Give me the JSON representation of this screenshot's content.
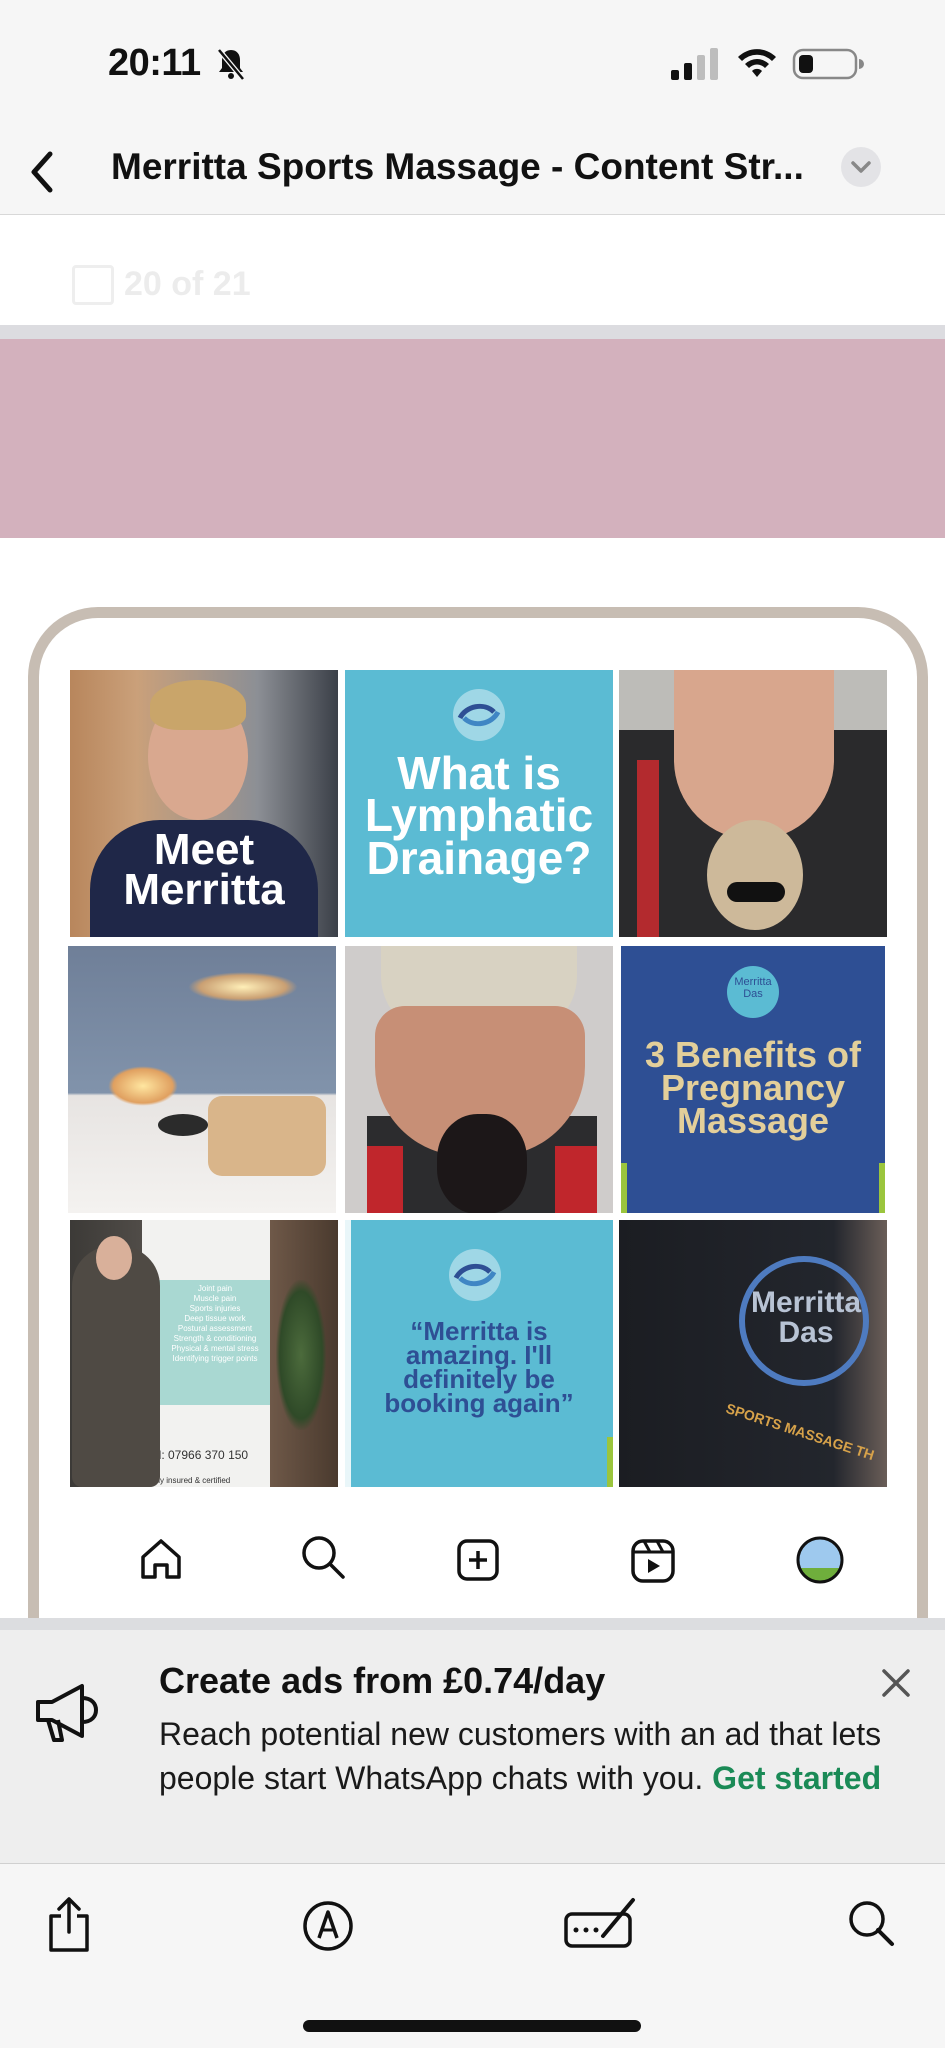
{
  "status_bar": {
    "time": "20:11"
  },
  "header": {
    "title": "Merritta Sports Massage - Content Str..."
  },
  "page_indicator": {
    "text": "20 of 21"
  },
  "grid": {
    "tile1_text": [
      "Meet",
      "Merritta"
    ],
    "tile2_text": [
      "What is",
      "Lymphatic",
      "Drainage?"
    ],
    "tile6_logo_text": [
      "Merritta",
      "Das"
    ],
    "tile6_text": [
      "3 Benefits of",
      "Pregnancy",
      "Massage"
    ],
    "tile7_poster_lines": [
      "Joint pain",
      "Muscle pain",
      "Sports injuries",
      "Deep tissue work",
      "Postural assessment",
      "Strength & conditioning",
      "Physical & mental stress",
      "Identifying trigger points"
    ],
    "tile7_phone": "el: 07966 370 150",
    "tile7_footer": "ully insured & certified",
    "tile8_text": [
      "“Merritta is",
      "amazing. I'll",
      "definitely be",
      "booking again”"
    ],
    "tile9_logo_text": [
      "Merritta",
      "Das"
    ],
    "tile9_arc_text": "SPORTS MASSAGE TH"
  },
  "ad": {
    "title": "Create ads from £0.74/day",
    "body": "Reach potential new customers with an ad that lets people start WhatsApp chats with you.",
    "cta": "Get started"
  },
  "colors": {
    "pink_banner": "#d3b1bd",
    "frame": "#c7bdb3",
    "teal": "#5bbbd3",
    "navy": "#2e4f94",
    "gold": "#e3cf9a",
    "cta_green": "#1a8a56"
  },
  "icons": [
    "bell-slash-icon",
    "signal-icon",
    "wifi-icon",
    "battery-icon",
    "back-icon",
    "chevron-down-icon",
    "home-icon",
    "search-icon",
    "add-post-icon",
    "reels-icon",
    "profile-avatar-icon",
    "megaphone-icon",
    "close-icon",
    "share-icon",
    "markup-icon",
    "keyboard-pen-icon",
    "find-icon"
  ]
}
